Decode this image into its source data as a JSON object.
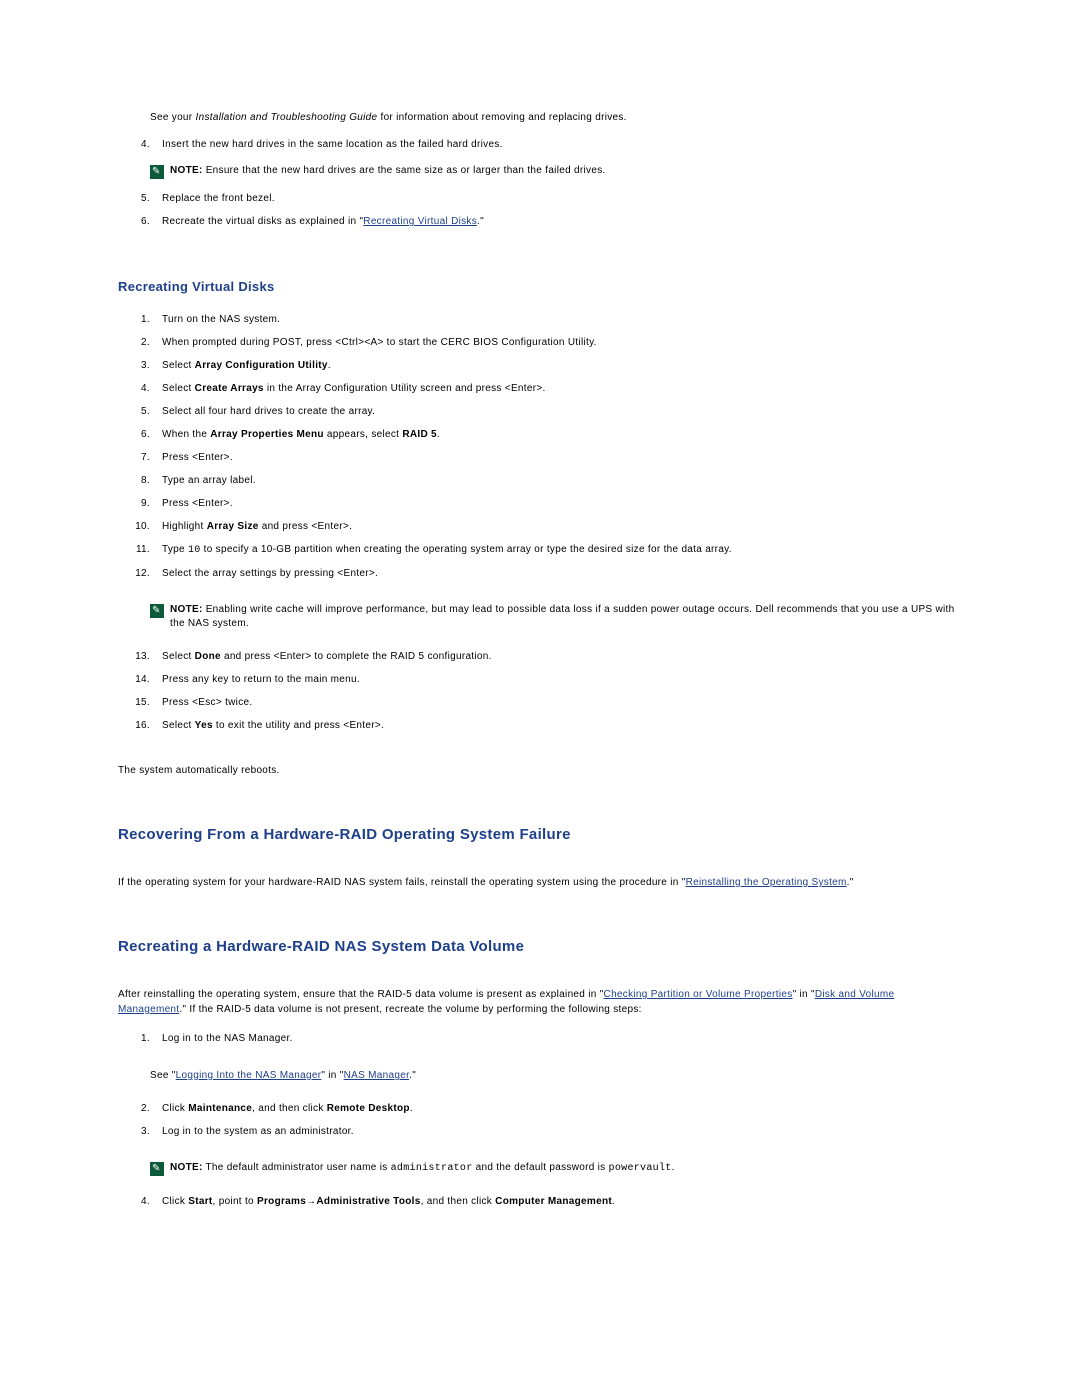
{
  "intro": {
    "guide_prefix": "See your ",
    "guide_italic": "Installation and Troubleshooting Guide",
    "guide_suffix": " for information about removing and replacing drives."
  },
  "top_steps": {
    "s4": "Insert the new hard drives in the same location as the failed hard drives.",
    "note1_label": "NOTE:",
    "note1": " Ensure that the new hard drives are the same size as or larger than the failed drives.",
    "s5": "Replace the front bezel.",
    "s6_pre": "Recreate the virtual disks as explained in \"",
    "s6_link": "Recreating Virtual Disks",
    "s6_post": ".\""
  },
  "sec1": {
    "title": "Recreating Virtual Disks",
    "s1": "Turn on the NAS system.",
    "s2": "When prompted during POST, press <Ctrl><A> to start the CERC BIOS Configuration Utility.",
    "s3_a": "Select ",
    "s3_b": "Array Configuration Utility",
    "s3_c": ".",
    "s4_a": "Select ",
    "s4_b": "Create Arrays",
    "s4_c": " in the Array Configuration Utility screen and press <Enter>.",
    "s5": "Select all four hard drives to create the array.",
    "s6_a": "When the ",
    "s6_b": "Array Properties Menu",
    "s6_c": " appears, select ",
    "s6_d": "RAID 5",
    "s6_e": ".",
    "s7": "Press <Enter>.",
    "s8": "Type an array label.",
    "s9": "Press <Enter>.",
    "s10_a": "Highlight ",
    "s10_b": "Array Size",
    "s10_c": " and press <Enter>.",
    "s11_a": "Type ",
    "s11_code": "10",
    "s11_b": " to specify a 10-GB partition when creating the operating system array or type the desired size for the data array.",
    "s12": "Select the array settings by pressing <Enter>.",
    "note2_label": "NOTE:",
    "note2": " Enabling write cache will improve performance, but may lead to possible data loss if a sudden power outage occurs. Dell recommends that you use a UPS with the NAS system.",
    "s13_a": "Select ",
    "s13_b": "Done",
    "s13_c": " and press <Enter> to complete the RAID 5 configuration.",
    "s14": "Press any key to return to the main menu.",
    "s15": "Press <Esc> twice.",
    "s16_a": "Select ",
    "s16_b": "Yes",
    "s16_c": " to exit the utility and press <Enter>.",
    "tail": "The system automatically reboots."
  },
  "sec2": {
    "title": "Recovering From a Hardware-RAID Operating System Failure",
    "para_a": "If the operating system for your hardware-RAID NAS system fails, reinstall the operating system using the procedure in \"",
    "para_link": "Reinstalling the Operating System",
    "para_b": ".\""
  },
  "sec3": {
    "title": "Recreating a Hardware-RAID NAS System Data Volume",
    "para_a": "After reinstalling the operating system, ensure that the RAID-5 data volume is present as explained in \"",
    "link1": "Checking Partition or Volume Properties",
    "para_b": "\" in \"",
    "link2": "Disk and Volume Management",
    "para_c": ".\" If the RAID-5 data volume is not present, recreate the volume by performing the following steps:",
    "s1": "Log in to the NAS Manager.",
    "s1_sub_a": "See \"",
    "s1_link1": "Logging Into the NAS Manager",
    "s1_sub_b": "\" in \"",
    "s1_link2": "NAS Manager",
    "s1_sub_c": ".\"",
    "s2_a": "Click ",
    "s2_b": "Maintenance",
    "s2_c": ", and then click ",
    "s2_d": "Remote Desktop",
    "s2_e": ".",
    "s3": "Log in to the system as an administrator.",
    "note3_label": "NOTE:",
    "note3_a": " The default administrator user name is ",
    "note3_code1": "administrator",
    "note3_b": " and the default password is ",
    "note3_code2": "powervault",
    "note3_c": ".",
    "s4_a": "Click ",
    "s4_b": "Start",
    "s4_c": ", point to ",
    "s4_d": "Programs",
    "s4_e": "→",
    "s4_f": "Administrative Tools",
    "s4_g": ", and then click ",
    "s4_h": "Computer Management",
    "s4_i": "."
  }
}
